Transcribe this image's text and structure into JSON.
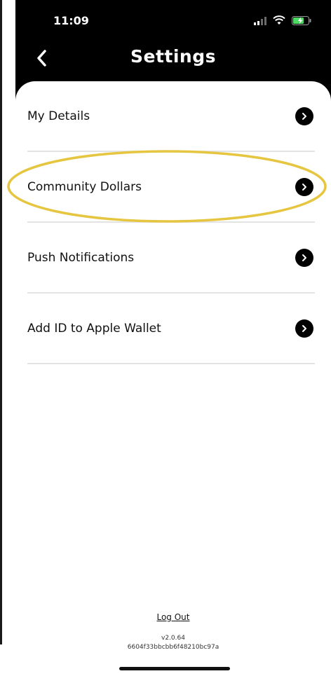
{
  "status_bar": {
    "time": "11:09"
  },
  "header": {
    "title": "Settings",
    "back_icon": "chevron-left-icon"
  },
  "settings": {
    "items": [
      {
        "label": "My Details",
        "icon": "chevron-right-icon"
      },
      {
        "label": "Community Dollars",
        "icon": "chevron-right-icon",
        "highlighted": true
      },
      {
        "label": "Push Notifications",
        "icon": "chevron-right-icon"
      },
      {
        "label": "Add ID to Apple Wallet",
        "icon": "chevron-right-icon"
      }
    ]
  },
  "footer": {
    "logout_label": "Log Out",
    "version": "v2.0.64",
    "build_hash": "6604f33bbcbb6f48210bc97a"
  },
  "colors": {
    "header_bg": "#000000",
    "highlight_ring": "#e6c640",
    "divider": "#e3e3e3"
  }
}
